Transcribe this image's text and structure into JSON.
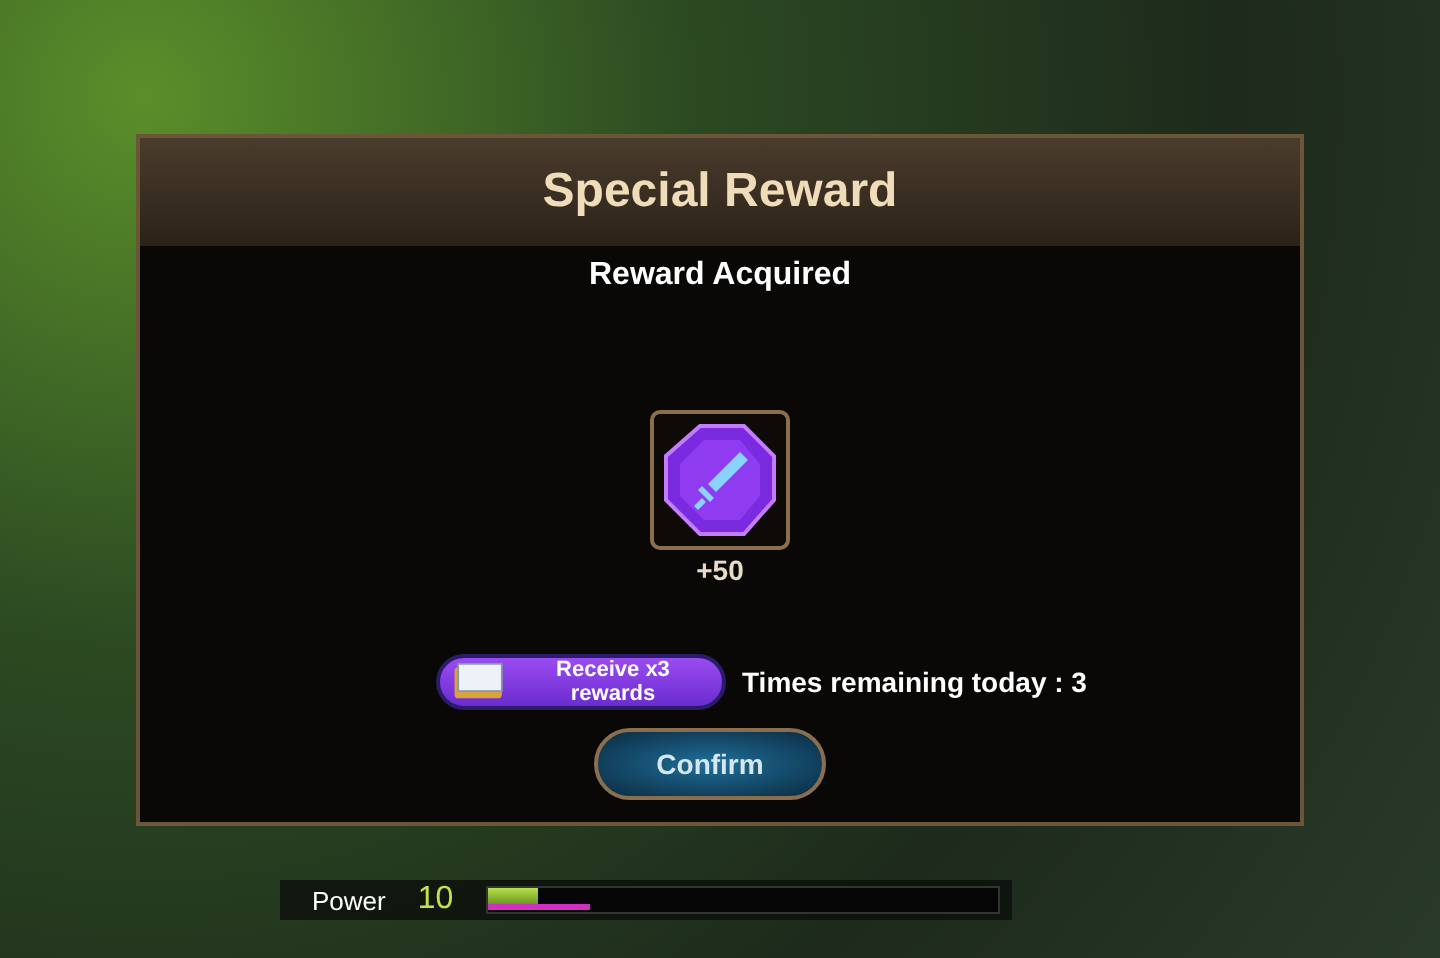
{
  "dialog": {
    "title": "Special Reward",
    "subtitle": "Reward Acquired",
    "reward": {
      "amount": "+50"
    },
    "bonus_button": {
      "label": "Receive x3 rewards"
    },
    "times_remaining": "Times remaining today : 3",
    "confirm_button": {
      "label": "Confirm"
    }
  },
  "power_bar": {
    "label": "Power",
    "value": "10",
    "primary": {
      "level": 0.1
    },
    "secondary": {
      "level": 0.2
    }
  }
}
